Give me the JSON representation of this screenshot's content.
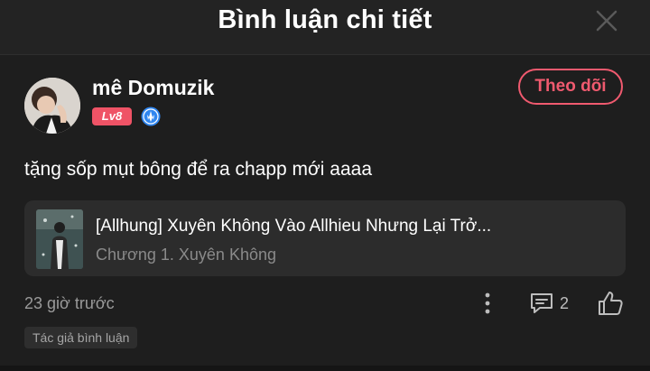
{
  "header": {
    "title": "Bình luận chi tiết"
  },
  "comment": {
    "username": "mê Domuzik",
    "level": "Lv8",
    "follow_label": "Theo dõi",
    "text": "tặng sốp mụt bông để ra chapp mới aaaa",
    "timestamp": "23 giờ trước",
    "reply_count": "2",
    "author_tag": "Tác giả bình luận"
  },
  "book": {
    "title": "[Allhung] Xuyên Không Vào Allhieu Nhưng Lại Trở...",
    "chapter": "Chương 1. Xuyên Không"
  },
  "colors": {
    "background": "#1e1e1e",
    "accent": "#f05a6f",
    "level_badge": "#ef5366",
    "card": "#2c2c2c",
    "muted_text": "#9a9a9a",
    "creator_icon": "#2f86f0"
  },
  "icons": {
    "close": "close-icon",
    "creator": "creator-badge-icon",
    "more": "more-vertical-icon",
    "reply": "comment-icon",
    "like": "thumbs-up-icon"
  }
}
